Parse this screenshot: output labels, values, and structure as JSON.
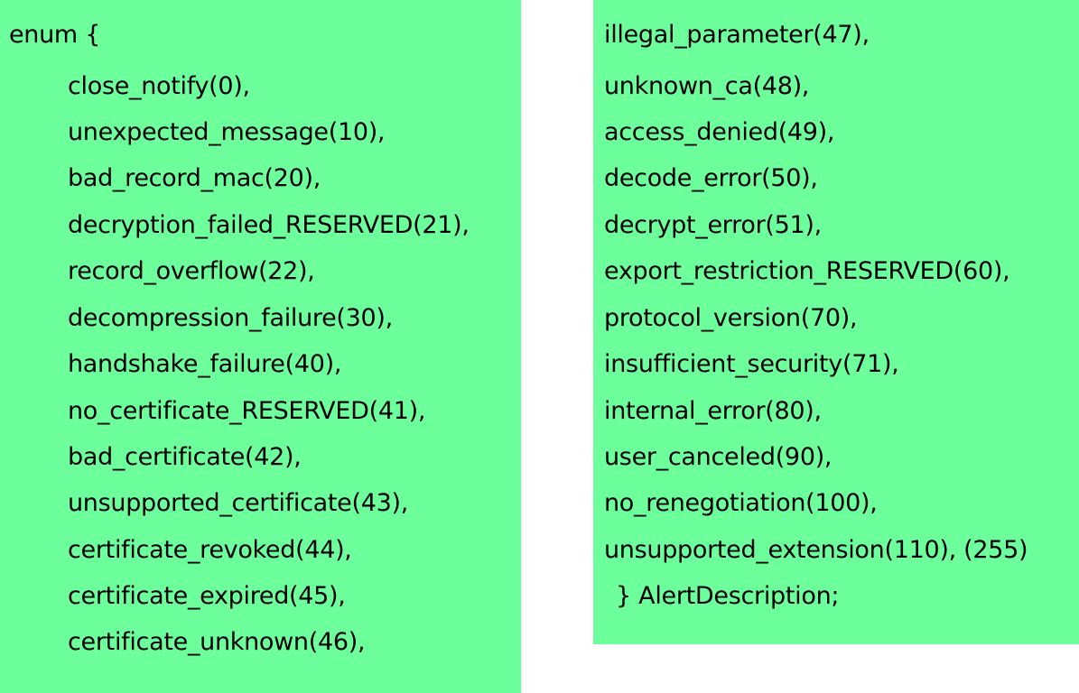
{
  "left_column": {
    "header": "enum {",
    "items": [
      "close_notify(0),",
      "unexpected_message(10),",
      "bad_record_mac(20),",
      "decryption_failed_RESERVED(21),",
      "record_overflow(22),",
      "decompression_failure(30),",
      "handshake_failure(40),",
      "no_certificate_RESERVED(41),",
      "bad_certificate(42),",
      "unsupported_certificate(43),",
      "certificate_revoked(44),",
      "certificate_expired(45),",
      "certificate_unknown(46),"
    ]
  },
  "right_column": {
    "items": [
      "illegal_parameter(47),",
      "unknown_ca(48),",
      "access_denied(49),",
      "decode_error(50),",
      "decrypt_error(51),",
      "export_restriction_RESERVED(60),",
      "protocol_version(70),",
      "insufficient_security(71),",
      "internal_error(80),",
      "user_canceled(90),",
      "no_renegotiation(100),",
      "unsupported_extension(110),  (255)"
    ],
    "closing": "} AlertDescription;"
  },
  "colors": {
    "panel_background": "#6dff9b",
    "text": "#000000"
  }
}
